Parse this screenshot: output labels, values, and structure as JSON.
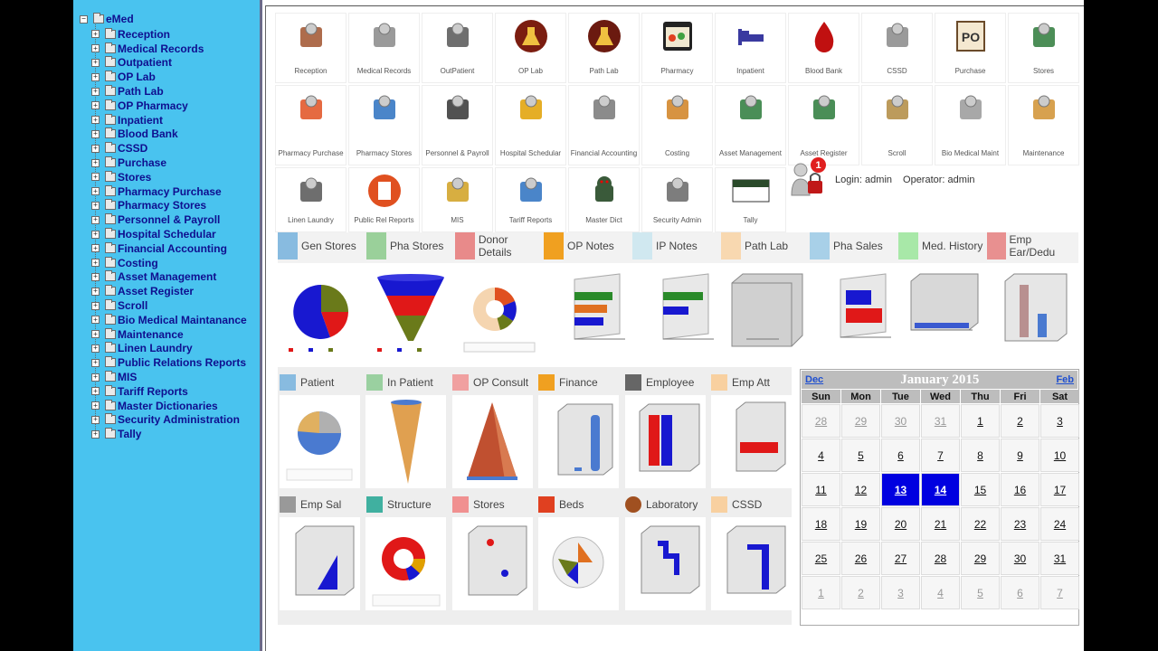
{
  "tree": {
    "root": "eMed",
    "items": [
      "Reception",
      "Medical Records",
      "Outpatient",
      "OP Lab",
      "Path Lab",
      "OP Pharmacy",
      "Inpatient",
      "Blood Bank",
      "CSSD",
      "Purchase",
      "Stores",
      "Pharmacy Purchase",
      "Pharmacy Stores",
      "Personnel & Payroll",
      "Hospital Schedular",
      "Financial Accounting",
      "Costing",
      "Asset Management",
      "Asset Register",
      "Scroll",
      "Bio Medical Maintanance",
      "Maintenance",
      "Linen Laundry",
      "Public Relations Reports",
      "MIS",
      "Tariff Reports",
      "Master Dictionaries",
      "Security Administration",
      "Tally"
    ]
  },
  "modules": {
    "row1": [
      {
        "label": "Reception",
        "icon": "reception-desk-icon",
        "color": "#a0522d"
      },
      {
        "label": "Medical Records",
        "icon": "medical-records-icon",
        "color": "#888888"
      },
      {
        "label": "OutPatient",
        "icon": "outpatient-icon",
        "color": "#555555"
      },
      {
        "label": "OP Lab",
        "icon": "microscope-icon",
        "color": "#7b1d10"
      },
      {
        "label": "Path Lab",
        "icon": "flask-icon",
        "color": "#6b1a10"
      },
      {
        "label": "Pharmacy",
        "icon": "pharmacy-icon",
        "color": "#2a8a2a"
      },
      {
        "label": "Inpatient",
        "icon": "bed-icon",
        "color": "#3a3aa0"
      },
      {
        "label": "Blood Bank",
        "icon": "blood-drop-icon",
        "color": "#c01010"
      },
      {
        "label": "CSSD",
        "icon": "cssd-icon",
        "color": "#888888"
      },
      {
        "label": "Purchase",
        "icon": "purchase-order-icon",
        "color": "#6b4b2a"
      },
      {
        "label": "Stores",
        "icon": "stores-icon",
        "color": "#2d7a3a"
      }
    ],
    "row2": [
      {
        "label": "Pharmacy Purchase",
        "icon": "shopping-cart-icon",
        "color": "#e05020"
      },
      {
        "label": "Pharmacy Stores",
        "icon": "pharmacy-stores-icon",
        "color": "#2a70c0"
      },
      {
        "label": "Personnel & Payroll",
        "icon": "personnel-icon",
        "color": "#333333"
      },
      {
        "label": "Hospital Schedular",
        "icon": "globe-schedule-icon",
        "color": "#e0a000"
      },
      {
        "label": "Financial Accounting",
        "icon": "cash-register-icon",
        "color": "#777777"
      },
      {
        "label": "Costing",
        "icon": "costing-chart-icon",
        "color": "#d08020"
      },
      {
        "label": "Asset Management",
        "icon": "asset-management-icon",
        "color": "#2a7a3a"
      },
      {
        "label": "Asset Register",
        "icon": "asset-register-icon",
        "color": "#2a7a3a"
      },
      {
        "label": "Scroll",
        "icon": "scroll-icon",
        "color": "#b08a40"
      },
      {
        "label": "Bio Medical Maint",
        "icon": "bio-medical-icon",
        "color": "#999999"
      },
      {
        "label": "Maintenance",
        "icon": "clipboard-icon",
        "color": "#d09030"
      }
    ],
    "row3": [
      {
        "label": "Linen Laundry",
        "icon": "linen-icon",
        "color": "#555555"
      },
      {
        "label": "Public Rel Reports",
        "icon": "report-icon",
        "color": "#e05020"
      },
      {
        "label": "MIS",
        "icon": "mis-cylinder-icon",
        "color": "#d0a020"
      },
      {
        "label": "Tariff Reports",
        "icon": "tariff-chart-icon",
        "color": "#2a70c0"
      },
      {
        "label": "Master Dict",
        "icon": "android-icon",
        "color": "#3a7a3a"
      },
      {
        "label": "Security Admin",
        "icon": "keys-icon",
        "color": "#666666"
      },
      {
        "label": "Tally",
        "icon": "tally-icon",
        "color": "#2a4a2a"
      }
    ],
    "login": {
      "login_label": "Login:",
      "login_user": "admin",
      "operator_label": "Operator:",
      "operator_user": "admin",
      "badge": "1"
    }
  },
  "report_tabs": [
    {
      "label": "Gen Stores",
      "icon": "gen-stores-icon",
      "color": "#88bbe0"
    },
    {
      "label": "Pha Stores",
      "icon": "pha-stores-icon",
      "color": "#9ad09a"
    },
    {
      "label": "Donor Details",
      "icon": "donor-icon",
      "color": "#e88a8a"
    },
    {
      "label": "OP Notes",
      "icon": "op-notes-icon",
      "color": "#f0a020"
    },
    {
      "label": "IP Notes",
      "icon": "ip-notes-icon",
      "color": "#d0e8f0"
    },
    {
      "label": "Path Lab",
      "icon": "path-lab-icon",
      "color": "#f8d8b0"
    },
    {
      "label": "Pha Sales",
      "icon": "pha-sales-icon",
      "color": "#a8d0e8"
    },
    {
      "label": "Med. History",
      "icon": "med-history-icon",
      "color": "#a8e8a8"
    },
    {
      "label": "Emp Ear/Dedu",
      "icon": "emp-ear-icon",
      "color": "#e89090"
    }
  ],
  "panels": {
    "row1": [
      {
        "label": "Patient",
        "icon": "patient-icon",
        "color": "#88bbe0"
      },
      {
        "label": "In Patient",
        "icon": "in-patient-icon",
        "color": "#9ad0a0"
      },
      {
        "label": "OP Consult",
        "icon": "op-consult-icon",
        "color": "#f0a0a0"
      },
      {
        "label": "Finance",
        "icon": "finance-icon",
        "color": "#f0a020"
      },
      {
        "label": "Employee",
        "icon": "employee-icon",
        "color": "#666666"
      },
      {
        "label": "Emp Att",
        "icon": "emp-att-icon",
        "color": "#f8d0a0"
      }
    ],
    "row2": [
      {
        "label": "Emp Sal",
        "icon": "emp-sal-icon",
        "color": "#999999"
      },
      {
        "label": "Structure",
        "icon": "structure-icon",
        "color": "#40b0a0"
      },
      {
        "label": "Stores",
        "icon": "panel-stores-icon",
        "color": "#f09090"
      },
      {
        "label": "Beds",
        "icon": "beds-icon",
        "color": "#e04020"
      },
      {
        "label": "Laboratory",
        "icon": "laboratory-icon",
        "color": "#a05020"
      },
      {
        "label": "CSSD",
        "icon": "panel-cssd-icon",
        "color": "#f8d0a0"
      }
    ]
  },
  "calendar": {
    "prev": "Dec",
    "title": "January 2015",
    "next": "Feb",
    "dow": [
      "Sun",
      "Mon",
      "Tue",
      "Wed",
      "Thu",
      "Fri",
      "Sat"
    ],
    "weeks": [
      [
        [
          "28",
          1
        ],
        [
          "29",
          1
        ],
        [
          "30",
          1
        ],
        [
          "31",
          1
        ],
        [
          "1",
          0
        ],
        [
          "2",
          0
        ],
        [
          "3",
          0
        ]
      ],
      [
        [
          "4",
          0
        ],
        [
          "5",
          0
        ],
        [
          "6",
          0
        ],
        [
          "7",
          0
        ],
        [
          "8",
          0
        ],
        [
          "9",
          0
        ],
        [
          "10",
          0
        ]
      ],
      [
        [
          "11",
          0
        ],
        [
          "12",
          0
        ],
        [
          "13",
          2
        ],
        [
          "14",
          2
        ],
        [
          "15",
          0
        ],
        [
          "16",
          0
        ],
        [
          "17",
          0
        ]
      ],
      [
        [
          "18",
          0
        ],
        [
          "19",
          0
        ],
        [
          "20",
          0
        ],
        [
          "21",
          0
        ],
        [
          "22",
          0
        ],
        [
          "23",
          0
        ],
        [
          "24",
          0
        ]
      ],
      [
        [
          "25",
          0
        ],
        [
          "26",
          0
        ],
        [
          "27",
          0
        ],
        [
          "28",
          0
        ],
        [
          "29",
          0
        ],
        [
          "30",
          0
        ],
        [
          "31",
          0
        ]
      ],
      [
        [
          "1",
          1
        ],
        [
          "2",
          1
        ],
        [
          "3",
          1
        ],
        [
          "4",
          1
        ],
        [
          "5",
          1
        ],
        [
          "6",
          1
        ],
        [
          "7",
          1
        ]
      ]
    ],
    "colors": {
      "selected": "#0000e0",
      "header": "#bdbdbd"
    }
  }
}
